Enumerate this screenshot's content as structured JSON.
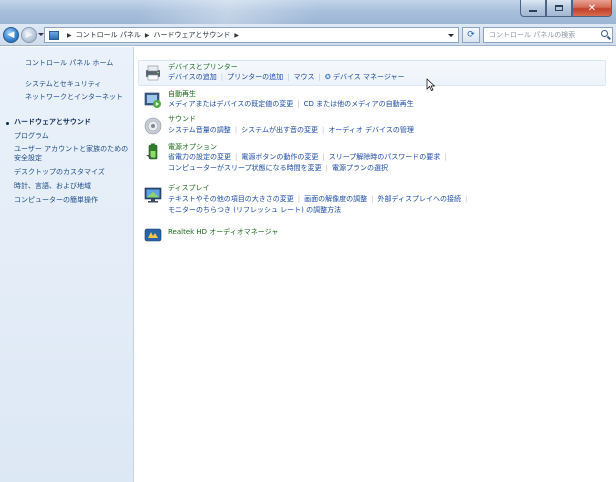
{
  "address_bar": {
    "crumbs": [
      "コントロール パネル",
      "ハードウェアとサウンド"
    ],
    "search_placeholder": "コントロール パネルの検索"
  },
  "left_nav": {
    "home": "コントロール パネル ホーム",
    "items": [
      "システムとセキュリティ",
      "ネットワークとインターネット",
      "ハードウェアとサウンド",
      "プログラム",
      "ユーザー アカウントと家族のための安全設定",
      "デスクトップのカスタマイズ",
      "時計、言語、および地域",
      "コンピューターの簡単操作"
    ],
    "current_index": 2
  },
  "categories": [
    {
      "icon": "printer-icon",
      "title": "デバイスとプリンター",
      "links": [
        "デバイスの追加",
        "プリンターの追加",
        "マウス",
        "デバイス マネージャー"
      ]
    },
    {
      "icon": "autoplay-icon",
      "title": "自動再生",
      "links": [
        "メディアまたはデバイスの既定値の変更",
        "CD または他のメディアの自動再生"
      ]
    },
    {
      "icon": "speaker-icon",
      "title": "サウンド",
      "links": [
        "システム音量の調整",
        "システムが出す音の変更",
        "オーディオ デバイスの管理"
      ]
    },
    {
      "icon": "power-options-icon",
      "title": "電源オプション",
      "links": [
        "省電力の設定の変更",
        "電源ボタンの動作の変更",
        "スリープ解除時のパスワードの要求"
      ],
      "links2": [
        "コンピューターがスリープ状態になる時間を変更",
        "電源プランの選択"
      ]
    },
    {
      "icon": "display-icon",
      "title": "ディスプレイ",
      "links": [
        "テキストやその他の項目の大きさの変更",
        "画面の解像度の調整",
        "外部ディスプレイへの接続"
      ],
      "links2": [
        "モニターのちらつき (リフレッシュ レート) の調整方法"
      ]
    },
    {
      "icon": "realtek-audio-icon",
      "title": "Realtek HD オーディオマネージャ",
      "links": []
    }
  ]
}
